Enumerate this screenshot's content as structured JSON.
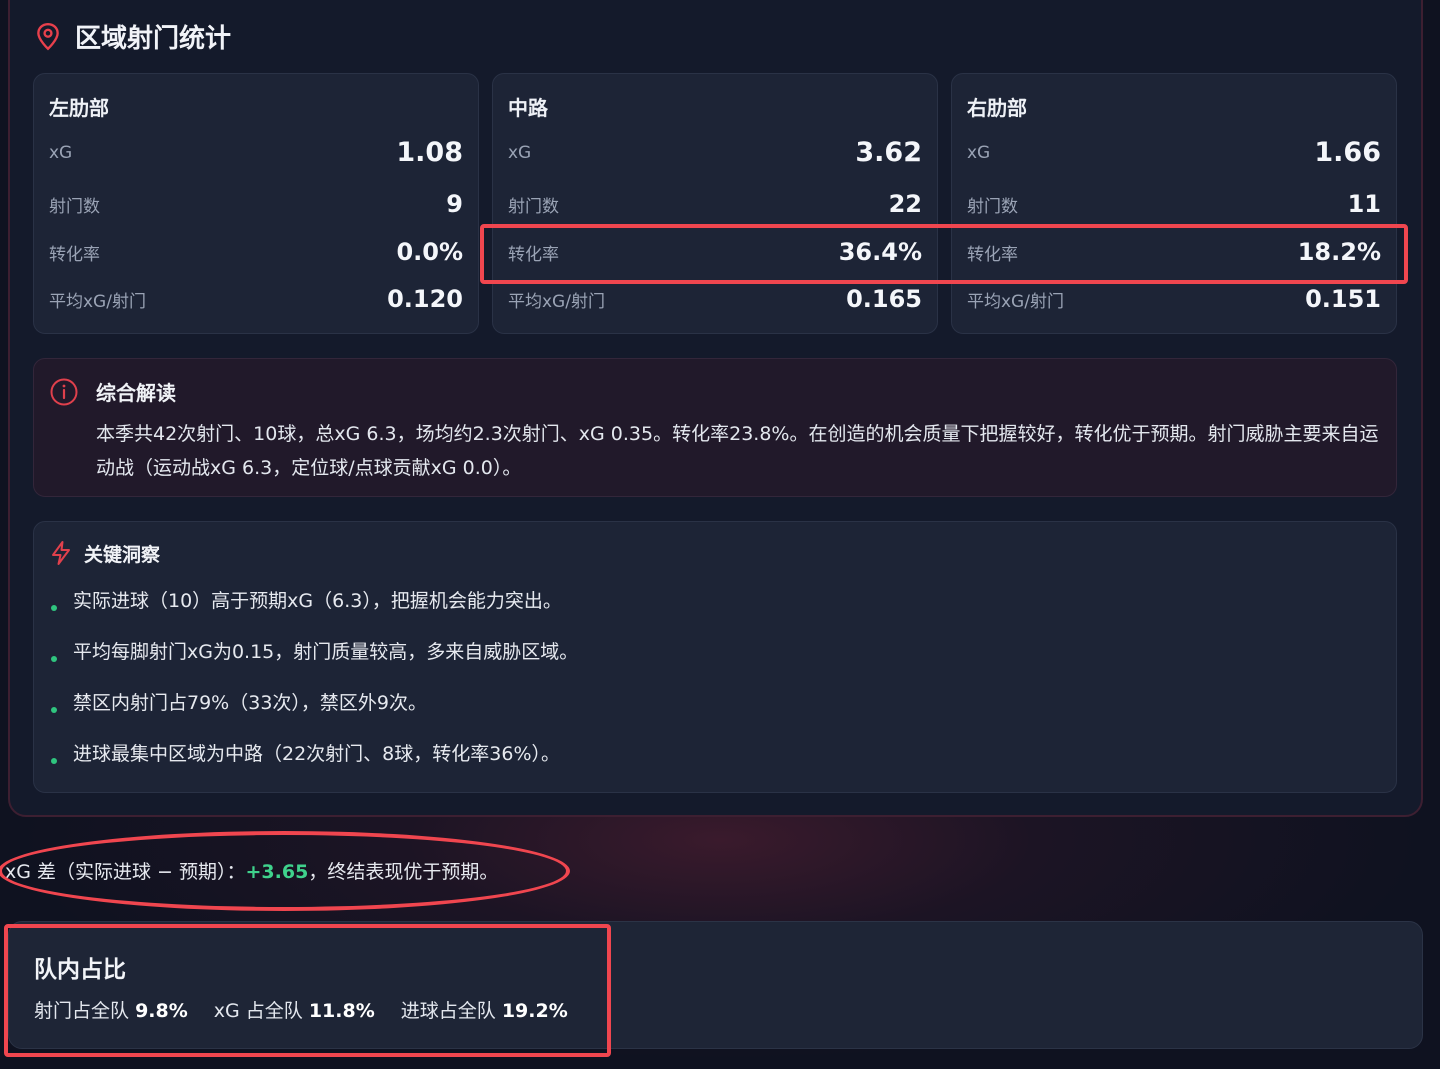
{
  "section": {
    "title": "区域射门统计",
    "icon": "map-pin-icon",
    "accent": "#f0464f"
  },
  "zones": [
    {
      "name": "左肋部",
      "xg_label": "xG",
      "xg": "1.08",
      "shots_label": "射门数",
      "shots": "9",
      "conv_label": "转化率",
      "conv": "0.0%",
      "avg_label": "平均xG/射门",
      "avg": "0.120"
    },
    {
      "name": "中路",
      "xg_label": "xG",
      "xg": "3.62",
      "shots_label": "射门数",
      "shots": "22",
      "conv_label": "转化率",
      "conv": "36.4%",
      "avg_label": "平均xG/射门",
      "avg": "0.165"
    },
    {
      "name": "右肋部",
      "xg_label": "xG",
      "xg": "1.66",
      "shots_label": "射门数",
      "shots": "11",
      "conv_label": "转化率",
      "conv": "18.2%",
      "avg_label": "平均xG/射门",
      "avg": "0.151"
    }
  ],
  "summary": {
    "title": "综合解读",
    "icon": "info-icon",
    "text": "本季共42次射门、10球，总xG 6.3，场均约2.3次射门、xG 0.35。转化率23.8%。在创造的机会质量下把握较好，转化优于预期。射门威胁主要来自运动战（运动战xG 6.3，定位球/点球贡献xG 0.0）。"
  },
  "insights": {
    "title": "关键洞察",
    "icon": "lightning-icon",
    "bullet_color": "#2fc57f",
    "items": [
      "实际进球（10）高于预期xG（6.3），把握机会能力突出。",
      "平均每脚射门xG为0.15，射门质量较高，多来自威胁区域。",
      "禁区内射门占79%（33次），禁区外9次。",
      "进球最集中区域为中路（22次射门、8球，转化率36%）。"
    ]
  },
  "xg_diff": {
    "prefix": "xG 差（实际进球 − 预期）：",
    "value": "+3.65",
    "suffix": "，终结表现优于预期。",
    "value_color": "#3fd28c"
  },
  "team_share": {
    "title": "队内占比",
    "shots_label": "射门占全队",
    "shots_value": "9.8%",
    "xg_label": "xG 占全队",
    "xg_value": "11.8%",
    "goals_label": "进球占全队",
    "goals_value": "19.2%"
  }
}
